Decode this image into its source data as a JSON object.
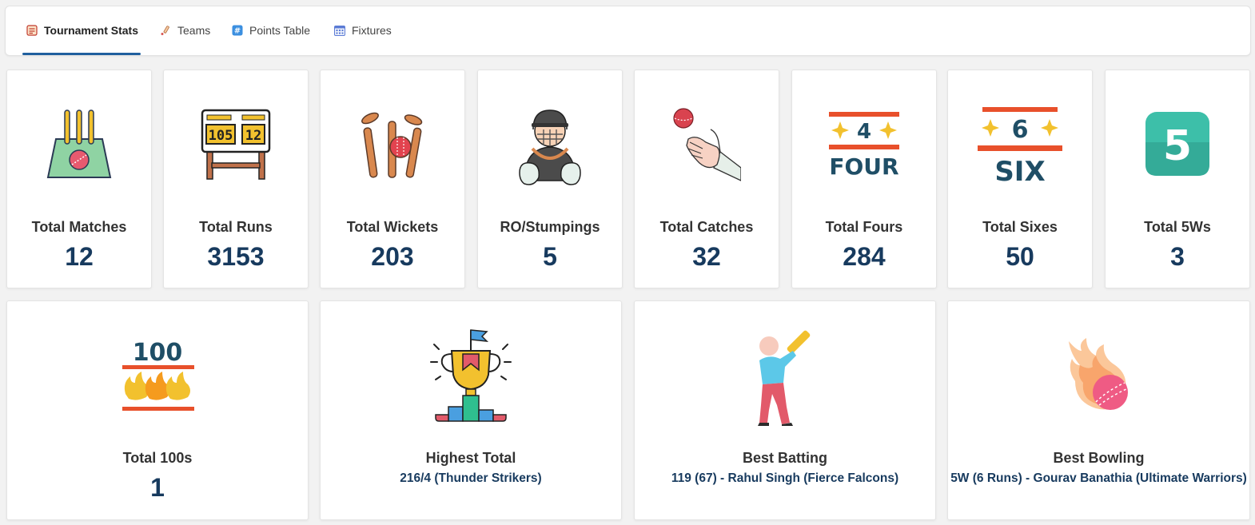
{
  "tabs": [
    {
      "label": "Tournament Stats",
      "icon": "scoreboard-icon",
      "active": true
    },
    {
      "label": "Teams",
      "icon": "bat-icon",
      "active": false
    },
    {
      "label": "Points Table",
      "icon": "hash-icon",
      "active": false
    },
    {
      "label": "Fixtures",
      "icon": "calendar-icon",
      "active": false
    }
  ],
  "stats": [
    {
      "label": "Total Matches",
      "value": "12",
      "icon": "pitch-stumps-icon"
    },
    {
      "label": "Total Runs",
      "value": "3153",
      "icon": "scoreboard-icon"
    },
    {
      "label": "Total Wickets",
      "value": "203",
      "icon": "broken-wicket-icon"
    },
    {
      "label": "RO/Stumpings",
      "value": "5",
      "icon": "wicketkeeper-icon"
    },
    {
      "label": "Total Catches",
      "value": "32",
      "icon": "catch-icon"
    },
    {
      "label": "Total Fours",
      "value": "284",
      "icon": "four-icon"
    },
    {
      "label": "Total Sixes",
      "value": "50",
      "icon": "six-icon"
    },
    {
      "label": "Total 5Ws",
      "value": "3",
      "icon": "five-wickets-icon"
    }
  ],
  "highlights": [
    {
      "label": "Total 100s",
      "value": "1",
      "detail": "",
      "icon": "century-icon"
    },
    {
      "label": "Highest Total",
      "value": "",
      "detail": "216/4 (Thunder Strikers)",
      "icon": "trophy-podium-icon"
    },
    {
      "label": "Best Batting",
      "value": "",
      "detail": "119 (67)  - Rahul Singh (Fierce Falcons)",
      "icon": "batsman-icon"
    },
    {
      "label": "Best Bowling",
      "value": "",
      "detail": "5W (6 Runs) - Gourav Banathia (Ultimate Warriors)",
      "icon": "fire-ball-icon"
    }
  ],
  "icon_text": {
    "score_left": "105",
    "score_right": "12",
    "four_digit": "4",
    "four_word": "FOUR",
    "six_digit": "6",
    "six_word": "SIX",
    "five": "5",
    "hundred": "100"
  },
  "colors": {
    "value_text": "#173a5e",
    "active_tab_underline": "#1f5f9e"
  }
}
